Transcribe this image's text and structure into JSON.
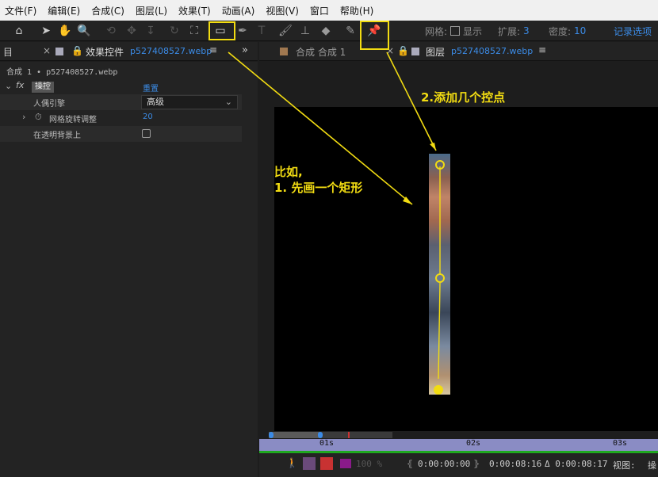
{
  "menu": [
    "文件(F)",
    "编辑(E)",
    "合成(C)",
    "图层(L)",
    "效果(T)",
    "动画(A)",
    "视图(V)",
    "窗口",
    "帮助(H)"
  ],
  "toolbar": {
    "grid_label": "网格:",
    "show_label": "显示",
    "expand_label": "扩展:",
    "expand_value": "3",
    "density_label": "密度:",
    "density_value": "10",
    "record_label": "记录选项"
  },
  "left_tabs": {
    "panel_icon": "目",
    "effects_label": "效果控件",
    "effects_file": "p527408527.webp"
  },
  "effect_panel": {
    "breadcrumb": "合成 1 • p527408527.webp",
    "effect_name": "操控",
    "reset_label": "重置",
    "rows": [
      {
        "label": "人偶引擎",
        "value": "高级"
      },
      {
        "label": "网格旋转调整",
        "value": "20"
      },
      {
        "label": "在透明背景上",
        "value": ""
      }
    ]
  },
  "right_tabs": {
    "comp_label": "合成 合成 1",
    "layer_label": "图层",
    "layer_file": "p527408527.webp"
  },
  "annotations": {
    "step2": "2.添加几个控点",
    "example": "比如,",
    "step1": "1. 先画一个矩形"
  },
  "timeline": {
    "ticks": [
      "01s",
      "02s",
      "03s"
    ],
    "zoom": "100 %",
    "start": "0:00:00:00",
    "end": "0:00:08:16",
    "duration": "Δ 0:00:08:17",
    "view_label": "视图:",
    "view_value": "操"
  },
  "colors": {
    "accent_blue": "#3b8be6",
    "annotation_yellow": "#f2dc12",
    "ruler": "#8a8cc4",
    "green_line": "#1fa81f"
  }
}
